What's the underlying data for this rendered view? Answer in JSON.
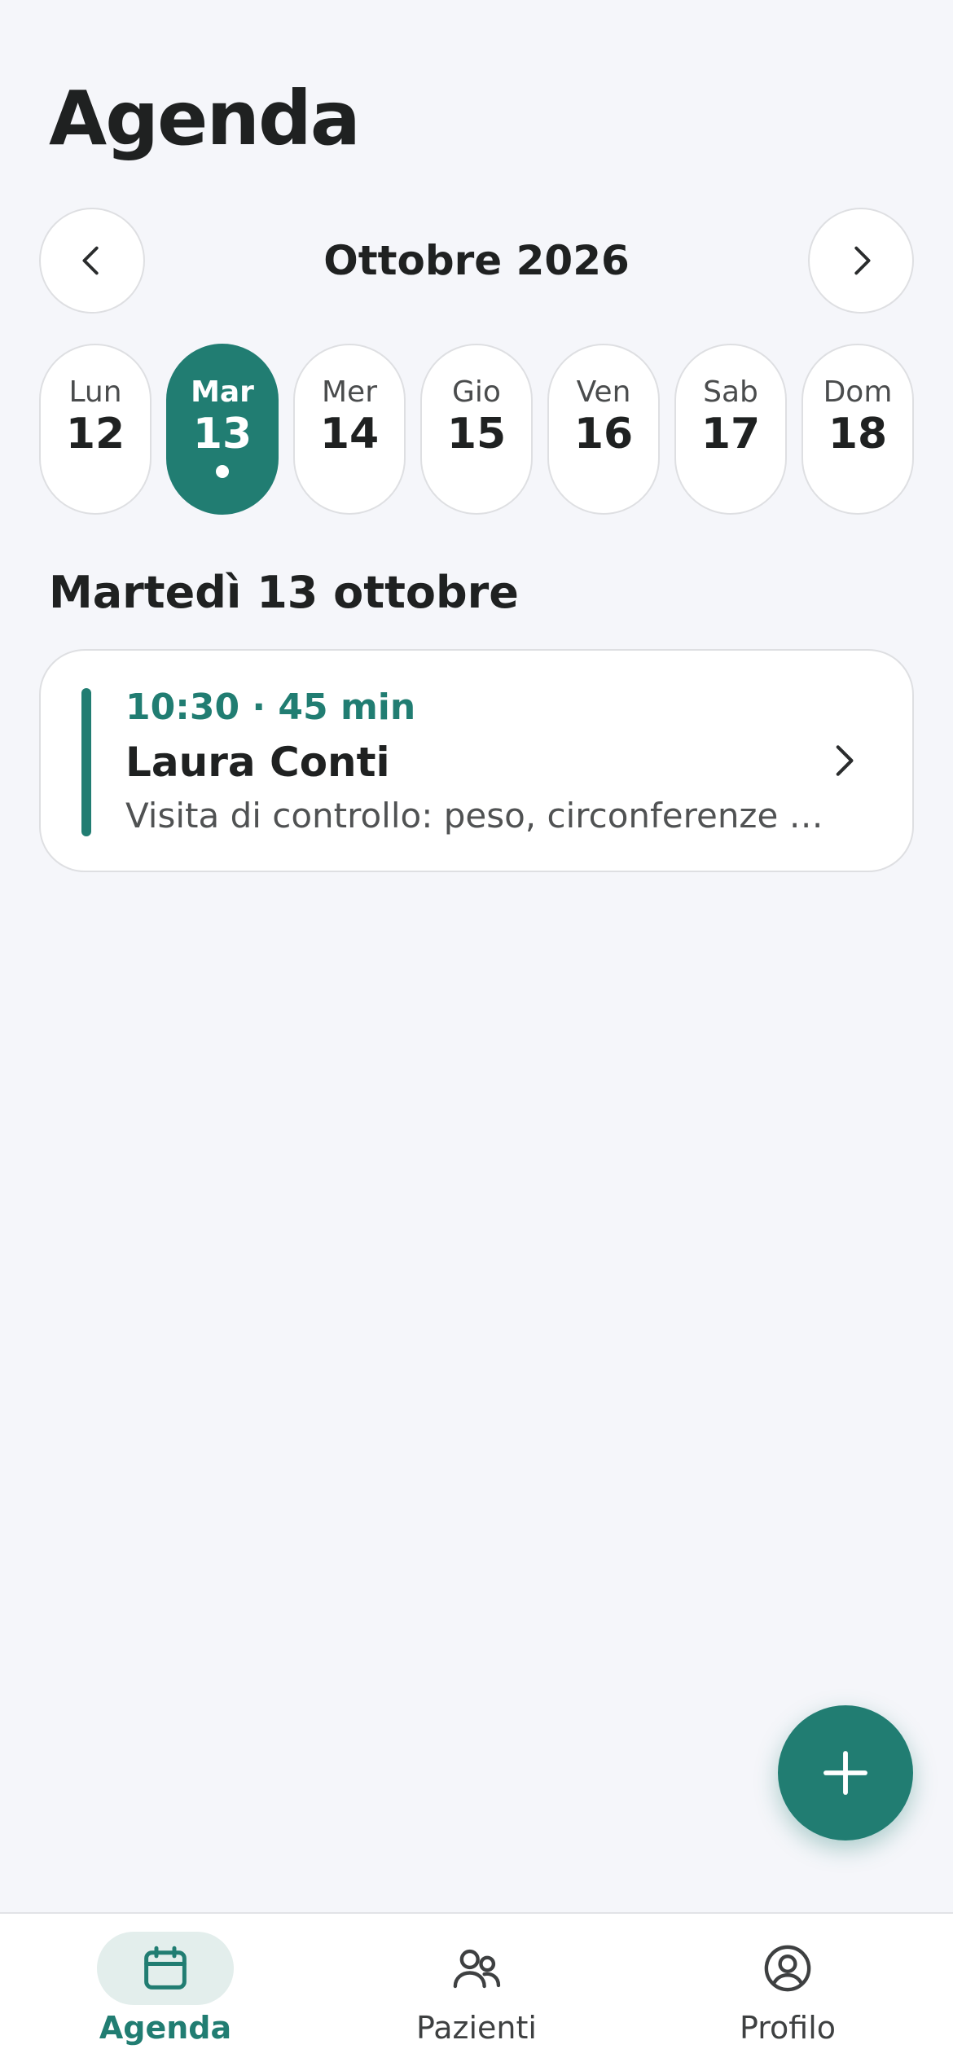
{
  "header": {
    "title": "Agenda"
  },
  "calendar": {
    "month_label": "Ottobre 2026",
    "days": [
      {
        "name": "Lun",
        "num": "12",
        "selected": false,
        "has_event": false
      },
      {
        "name": "Mar",
        "num": "13",
        "selected": true,
        "has_event": true
      },
      {
        "name": "Mer",
        "num": "14",
        "selected": false,
        "has_event": false
      },
      {
        "name": "Gio",
        "num": "15",
        "selected": false,
        "has_event": false
      },
      {
        "name": "Ven",
        "num": "16",
        "selected": false,
        "has_event": false
      },
      {
        "name": "Sab",
        "num": "17",
        "selected": false,
        "has_event": false
      },
      {
        "name": "Dom",
        "num": "18",
        "selected": false,
        "has_event": false
      }
    ]
  },
  "day_section": {
    "title": "Martedì 13 ottobre",
    "appointments": [
      {
        "time": "10:30 · 45 min",
        "patient": "Laura Conti",
        "description": "Visita di controllo: peso, circonferenze …"
      }
    ]
  },
  "fab": {
    "icon": "plus-icon"
  },
  "tabbar": {
    "items": [
      {
        "label": "Agenda",
        "icon": "calendar-icon",
        "active": true
      },
      {
        "label": "Pazienti",
        "icon": "users-icon",
        "active": false
      },
      {
        "label": "Profilo",
        "icon": "user-circle-icon",
        "active": false
      }
    ]
  },
  "colors": {
    "accent": "#217d72",
    "background": "#f5f6fa",
    "card": "#ffffff",
    "border": "#dedfe2",
    "text": "#1f2121",
    "active_tab_bg": "#e3eeec"
  }
}
